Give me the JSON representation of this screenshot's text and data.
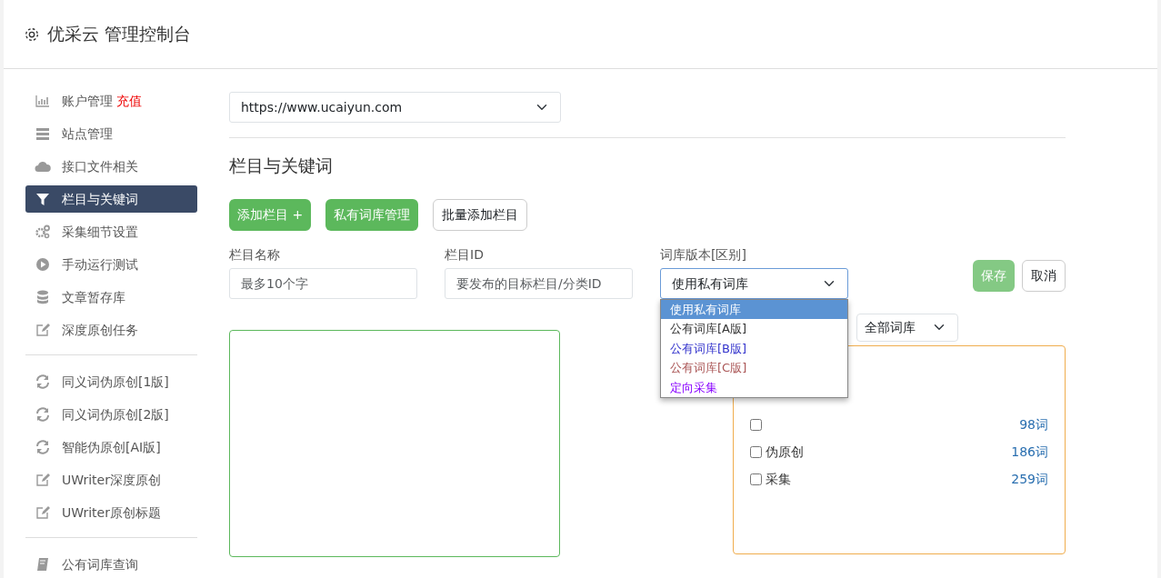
{
  "header": {
    "title": "优采云 管理控制台"
  },
  "sidebar": {
    "items": [
      {
        "label": "账户管理",
        "badge": "充值",
        "selected": false,
        "divider_before": false
      },
      {
        "label": "站点管理",
        "selected": false,
        "divider_before": false
      },
      {
        "label": "接口文件相关",
        "selected": false,
        "divider_before": false
      },
      {
        "label": "栏目与关键词",
        "selected": true,
        "divider_before": false
      },
      {
        "label": "采集细节设置",
        "selected": false,
        "divider_before": false
      },
      {
        "label": "手动运行测试",
        "selected": false,
        "divider_before": false
      },
      {
        "label": "文章暂存库",
        "selected": false,
        "divider_before": false
      },
      {
        "label": "深度原创任务",
        "selected": false,
        "divider_before": false
      },
      {
        "label": "同义词伪原创[1版]",
        "selected": false,
        "divider_before": true
      },
      {
        "label": "同义词伪原创[2版]",
        "selected": false,
        "divider_before": false
      },
      {
        "label": "智能伪原创[AI版]",
        "selected": false,
        "divider_before": false
      },
      {
        "label": "UWriter深度原创",
        "selected": false,
        "divider_before": false
      },
      {
        "label": "UWriter原创标题",
        "selected": false,
        "divider_before": false
      },
      {
        "label": "公有词库查询",
        "selected": false,
        "divider_before": true
      }
    ]
  },
  "site_select": {
    "value": "https://www.ucaiyun.com"
  },
  "section_title": "栏目与关键词",
  "toolbar": [
    {
      "label": "添加栏目 +",
      "kind": "success"
    },
    {
      "label": "私有词库管理",
      "kind": "success"
    },
    {
      "label": "批量添加栏目",
      "kind": "outline"
    }
  ],
  "form": {
    "name_label": "栏目名称",
    "name_placeholder": "最多10个字",
    "id_label": "栏目ID",
    "id_placeholder": "要发布的目标栏目/分类ID",
    "lib_label": "词库版本[区别]",
    "lib_value": "使用私有词库",
    "lib_options": [
      {
        "label": "使用私有词库",
        "selected": true
      },
      {
        "label": "公有词库[A版]",
        "selected": false,
        "color": "#333333"
      },
      {
        "label": "公有词库[B版]",
        "selected": false,
        "color": "#3333cc"
      },
      {
        "label": "公有词库[C版]",
        "selected": false,
        "color": "#aa5555"
      },
      {
        "label": "定向采集",
        "selected": false,
        "color": "#8800ff"
      }
    ],
    "save": "保存",
    "cancel": "取消"
  },
  "library_filter": "全部词库",
  "libraries": [
    {
      "count": "98词",
      "checked": false
    },
    {
      "label": "伪原创",
      "count": "186词",
      "checked": false
    },
    {
      "label": "采集",
      "count": "259词",
      "checked": false
    }
  ]
}
